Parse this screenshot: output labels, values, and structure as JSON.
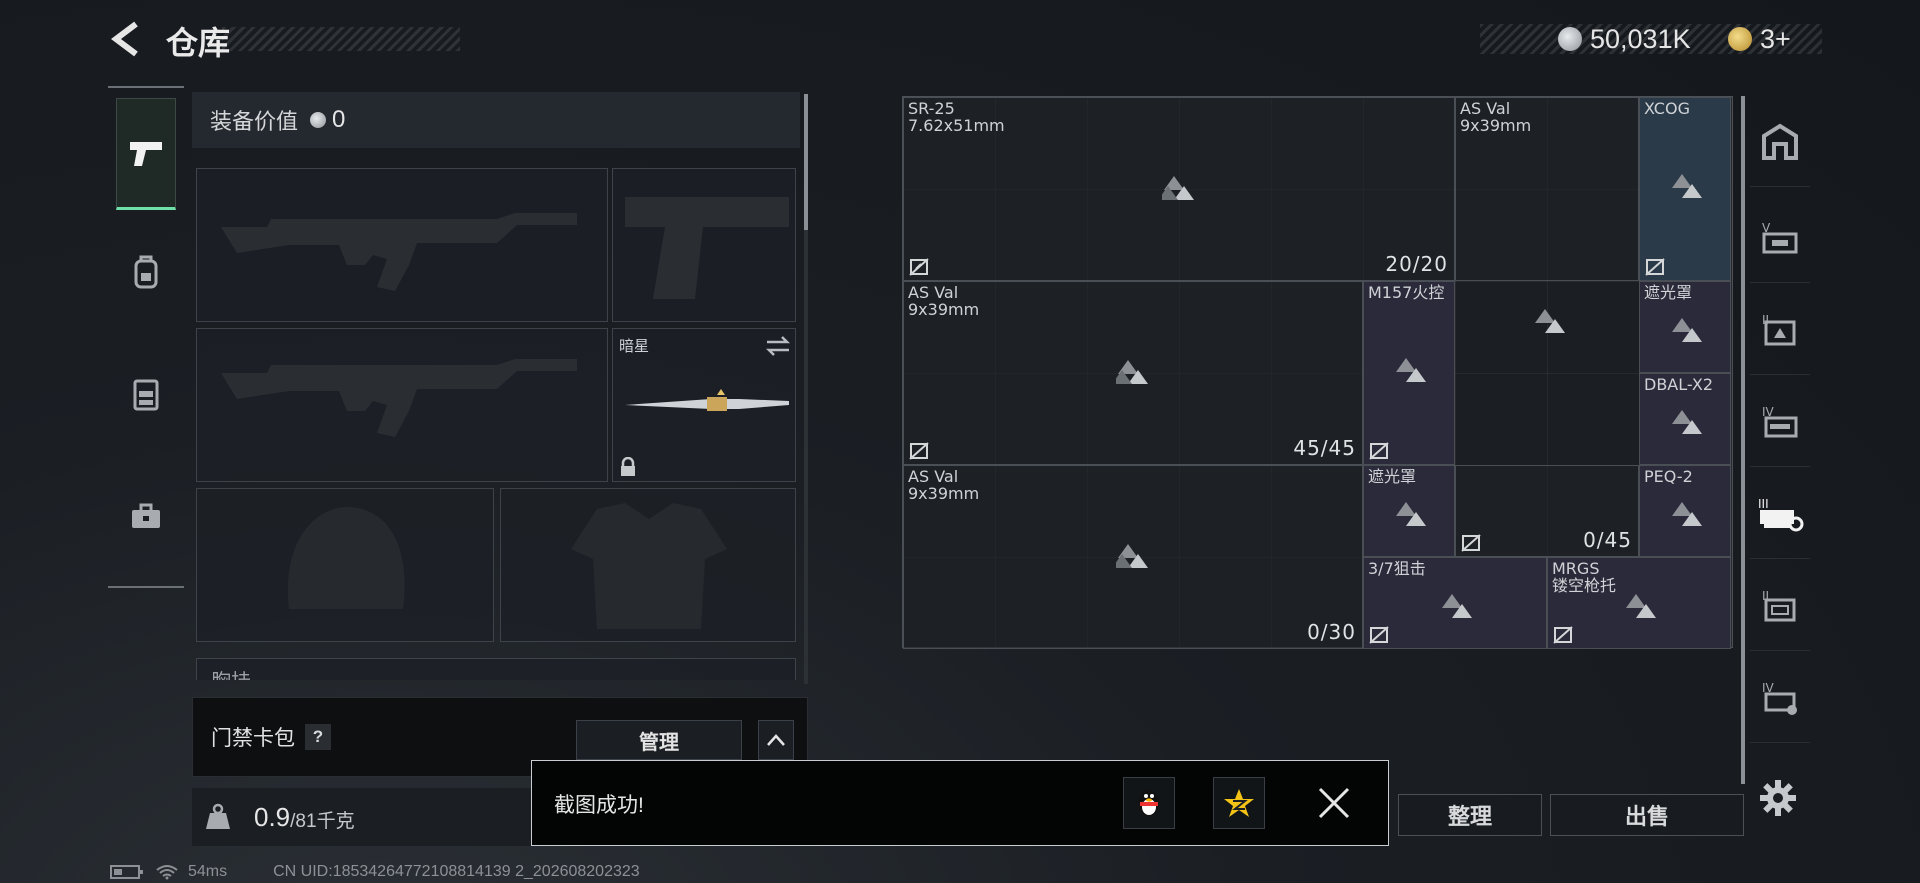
{
  "header": {
    "title": "仓库",
    "currency": [
      {
        "icon": "silver-coin-icon",
        "value": "50,031K"
      },
      {
        "icon": "gold-coin-icon",
        "value": "3+"
      }
    ]
  },
  "left_tabs": [
    {
      "icon": "pistol-icon",
      "active": true
    },
    {
      "icon": "backpack-icon",
      "active": false
    },
    {
      "icon": "chest-rig-icon",
      "active": false
    },
    {
      "icon": "toolbox-icon",
      "active": false
    }
  ],
  "equipment": {
    "value_label": "装备价值",
    "value": "0",
    "knife_label": "暗星",
    "chest_label": "胸挂"
  },
  "card_pack": {
    "label": "门禁卡包",
    "help": "?",
    "manage_label": "管理"
  },
  "weight": {
    "current": "0.9",
    "total": "/81千克"
  },
  "grid_items": [
    {
      "name": "SR-25\n7.62x51mm",
      "count": "20/20"
    },
    {
      "name": "AS Val\n9x39mm",
      "count": ""
    },
    {
      "name": "XCOG",
      "count": ""
    },
    {
      "name": "AS Val\n9x39mm",
      "count": "45/45"
    },
    {
      "name": "M157火控",
      "count": ""
    },
    {
      "name": "遮光罩",
      "count": ""
    },
    {
      "name": "DBAL-X2",
      "count": ""
    },
    {
      "name": "AS Val\n9x39mm",
      "count": "0/30"
    },
    {
      "name": "遮光罩",
      "count": ""
    },
    {
      "name": "",
      "count": "0/45"
    },
    {
      "name": "PEQ-2",
      "count": ""
    },
    {
      "name": "3/7狙击",
      "count": ""
    },
    {
      "name": "MRGS\n镂空枪托",
      "count": ""
    }
  ],
  "actions": {
    "sort_label": "整理",
    "sell_label": "出售"
  },
  "toast": {
    "message": "截图成功!"
  },
  "status_bar": {
    "ping": "54ms",
    "uid": "CN UID:18534264772108814139 2_202608202323"
  }
}
